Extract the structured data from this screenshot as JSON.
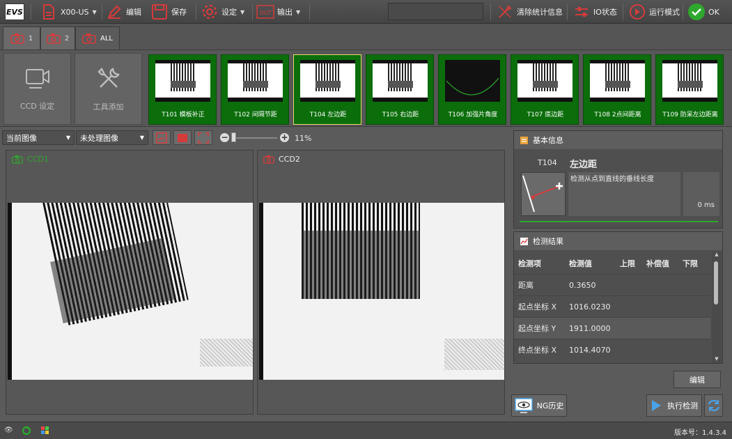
{
  "app": {
    "logo": "EVS"
  },
  "toolbar": {
    "model": "X00-US",
    "edit": "编辑",
    "save": "保存",
    "settings": "设定",
    "output": "输出",
    "clear_stats": "清除统计信息",
    "io_status": "IO状态",
    "run_mode": "运行模式",
    "ok": "OK"
  },
  "camera_tabs": [
    {
      "label": "1"
    },
    {
      "label": "2"
    },
    {
      "label": "ALL"
    }
  ],
  "tools": {
    "ccd_settings": "CCD 设定",
    "add_tool": "工具添加"
  },
  "steps": [
    {
      "label": "T101 模板补正"
    },
    {
      "label": "T102 间隔节距"
    },
    {
      "label": "T104 左边距"
    },
    {
      "label": "T105 右边距"
    },
    {
      "label": "T106 加强片角度"
    },
    {
      "label": "T107 底边距"
    },
    {
      "label": "T108 2点间距离"
    },
    {
      "label": "T109 防呆左边距离"
    }
  ],
  "view": {
    "image_select": "当前图像",
    "process_select": "未处理图像",
    "zoom": "11%"
  },
  "ccd_panels": [
    {
      "title": "CCD1"
    },
    {
      "title": "CCD2"
    }
  ],
  "basic_info": {
    "header": "基本信息",
    "tool_id": "T104",
    "tool_name": "左边距",
    "description": "检测从点到直线的垂线长度",
    "time": "0 ms"
  },
  "results": {
    "header": "检测结果",
    "columns": [
      "检测项",
      "检测值",
      "上限",
      "补偿值",
      "下限"
    ],
    "rows": [
      [
        "距离",
        "0.3650",
        "",
        "",
        ""
      ],
      [
        "起点坐标 X",
        "1016.0230",
        "",
        "",
        ""
      ],
      [
        "起点坐标 Y",
        "1911.0000",
        "",
        "",
        ""
      ],
      [
        "终点坐标 X",
        "1014.4070",
        "",
        "",
        ""
      ]
    ],
    "edit_button": "编辑"
  },
  "bottom": {
    "ng_history": "NG历史",
    "run_inspection": "执行检测"
  },
  "status": {
    "version": "版本号：1.4.3.4"
  },
  "colors": {
    "accent_red": "#d63b3b",
    "step_green": "#0b6e0b",
    "ok_green": "#2ea82e",
    "blue": "#4aa3e8"
  }
}
